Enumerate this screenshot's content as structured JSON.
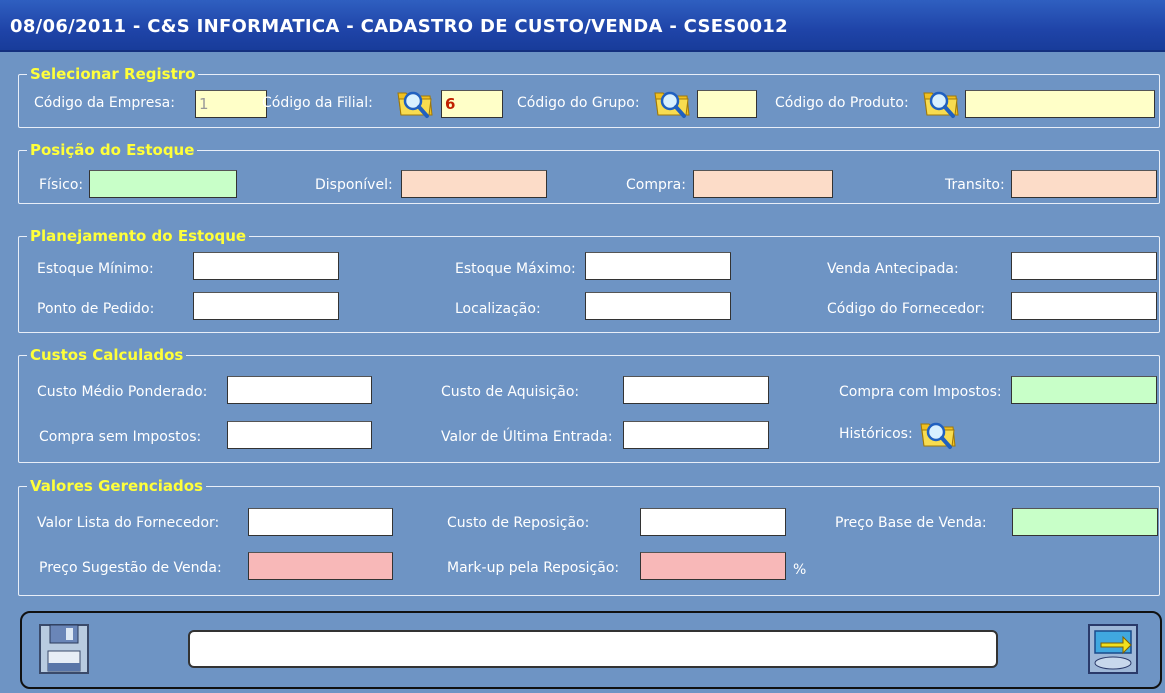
{
  "title": "08/06/2011  -  C&S INFORMATICA  -  CADASTRO DE CUSTO/VENDA  -  CSES0012",
  "sections": {
    "selecionar": {
      "legend": "Selecionar Registro",
      "empresa_label": "Código da Empresa:",
      "empresa_value": "1",
      "filial_label": "Código da Filial:",
      "filial_value": "6",
      "grupo_label": "Código do Grupo:",
      "grupo_value": "",
      "produto_label": "Código do Produto:",
      "produto_value": ""
    },
    "posicao": {
      "legend": "Posição do Estoque",
      "fisico_label": "Físico:",
      "disponivel_label": "Disponível:",
      "compra_label": "Compra:",
      "transito_label": "Transito:"
    },
    "planejamento": {
      "legend": "Planejamento do Estoque",
      "minimo_label": "Estoque Mínimo:",
      "maximo_label": "Estoque Máximo:",
      "antecipada_label": "Venda Antecipada:",
      "ponto_label": "Ponto de Pedido:",
      "localizacao_label": "Localização:",
      "fornecedor_label": "Código do  Fornecedor:"
    },
    "custos": {
      "legend": "Custos Calculados",
      "medio_label": "Custo Médio Ponderado:",
      "aquisicao_label": "Custo de Aquisição:",
      "com_impostos_label": "Compra com Impostos:",
      "sem_impostos_label": "Compra sem Impostos:",
      "ultima_label": "Valor de Última Entrada:",
      "historicos_label": "Históricos:"
    },
    "valores": {
      "legend": "Valores Gerenciados",
      "lista_label": "Valor Lista do Fornecedor:",
      "reposicao_label": "Custo de Reposição:",
      "base_label": "Preço Base de Venda:",
      "sugestao_label": "Preço Sugestão de Venda:",
      "markup_label": "Mark-up pela Reposição:",
      "percent": "%"
    }
  },
  "footer": {
    "status_text": "",
    "save_icon": "floppy-disk-icon",
    "exit_icon": "exit-return-icon"
  },
  "colors": {
    "background": "#6e94c4",
    "legend": "#ffff3a",
    "yellow_field": "#ffffc8",
    "green_field": "#c8ffc8",
    "orange_field": "#fcdcc8",
    "pink_field": "#f8b8b8"
  }
}
